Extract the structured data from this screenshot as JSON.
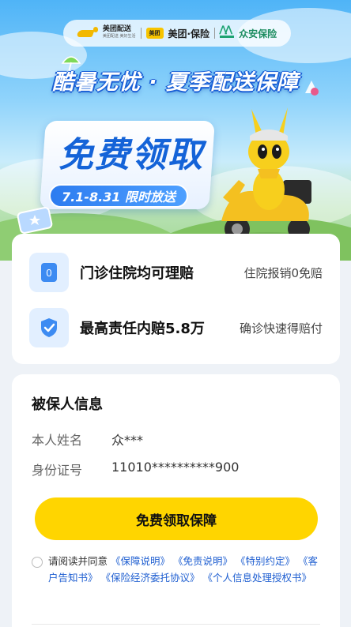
{
  "brand": {
    "meituan_delivery": "美团配送",
    "meituan_delivery_sub": "美团配送 美好生活",
    "meituan_insurance_logo": "美团",
    "meituan_insurance": "美团·保险",
    "zhongan": "众安保险"
  },
  "hero": {
    "headline": "酷暑无忧 · 夏季配送保障",
    "free_title": "免费领取",
    "date_range": "7.1-8.31 限时放送"
  },
  "benefits": [
    {
      "icon": "zero-badge-icon",
      "icon_text": "0",
      "title": "门诊住院均可理赔",
      "subtitle": "住院报销0免赔"
    },
    {
      "icon": "shield-check-icon",
      "title": "最高责任内赔5.8万",
      "subtitle": "确诊快速得赔付"
    }
  ],
  "insured": {
    "section_title": "被保人信息",
    "name_label": "本人姓名",
    "name_value": "众***",
    "id_label": "身份证号",
    "id_value": "11010**********900",
    "claim_button": "免费领取保障",
    "agree_prefix": "请阅读并同意",
    "docs": [
      "《保障说明》",
      "《免责说明》",
      "《特别约定》",
      "《客户告知书》",
      "《保险经济委托协议》",
      "《个人信息处理授权书》"
    ]
  },
  "colors": {
    "accent_yellow": "#ffd500",
    "brand_blue": "#1463d8",
    "link_blue": "#1f5fd1",
    "zhongan_green": "#1da372"
  }
}
